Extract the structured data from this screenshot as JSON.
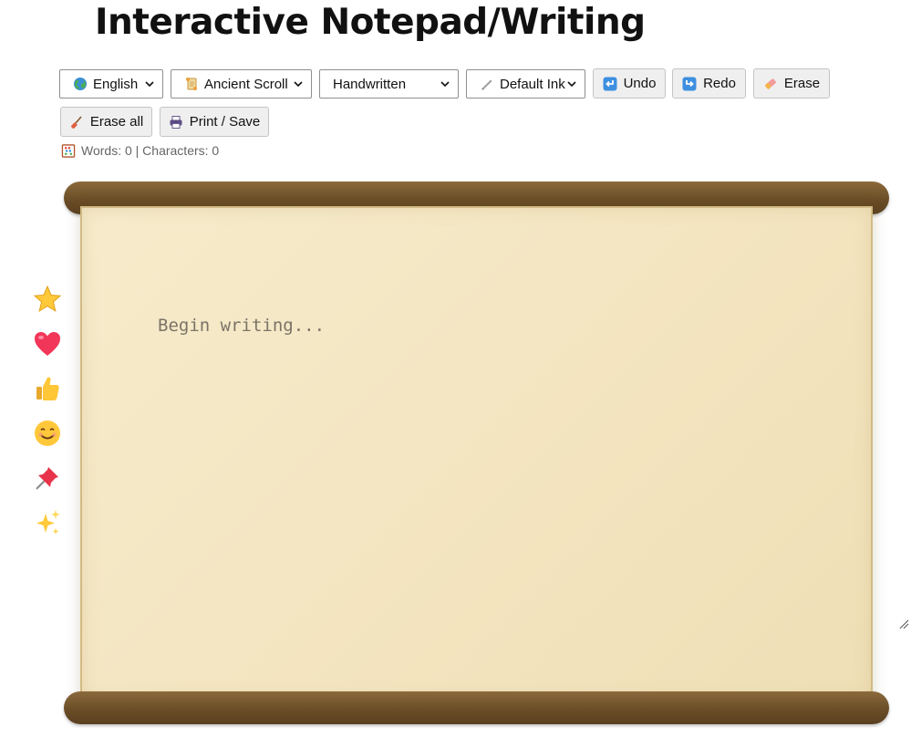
{
  "page": {
    "title": "Interactive Notepad/Writing"
  },
  "toolbar": {
    "language": {
      "value": "English",
      "icon": "globe-icon"
    },
    "theme": {
      "value": "Ancient Scroll",
      "icon": "scroll-icon"
    },
    "font": {
      "value": "Handwritten"
    },
    "ink": {
      "value": "Default Ink",
      "icon": "pen-icon"
    },
    "undo_label": "Undo",
    "redo_label": "Redo",
    "erase_label": "Erase",
    "erase_all_label": "Erase all",
    "print_label": "Print / Save"
  },
  "stats": {
    "text": "Words: 0 | Characters: 0",
    "icon": "abacus-icon"
  },
  "editor": {
    "placeholder": "Begin writing..."
  },
  "stickers": [
    "star-icon",
    "heart-icon",
    "thumbs-up-icon",
    "smiley-icon",
    "pushpin-icon",
    "sparkles-icon"
  ],
  "colors": {
    "roller": "#6b4e27",
    "paper": "#f4e6c3",
    "paper_border": "#d2ba83",
    "button_bg": "#efefef"
  }
}
